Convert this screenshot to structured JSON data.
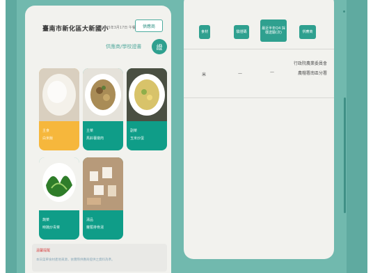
{
  "header": {
    "school_name": "臺南市新化區大新國小",
    "date": "2025年3月17日 午餐",
    "supplier_button": "供應商",
    "supplier_link": "供應商/學校證書",
    "round_button": "證"
  },
  "menu": {
    "items": [
      {
        "category": "主食",
        "name": "白米飯",
        "selected": true
      },
      {
        "category": "主菜",
        "name": "馬鈴薯燉肉",
        "selected": false
      },
      {
        "category": "副菜",
        "name": "玉米炒蛋",
        "selected": false
      },
      {
        "category": "蔬菜",
        "name": "時蔬炒青菜",
        "selected": false
      },
      {
        "category": "湯品",
        "name": "蘿蔔排骨湯",
        "selected": false
      }
    ]
  },
  "notice": {
    "title": "溫馨提醒",
    "text": "本日菜單食材產地來源，依實際供應商提供之資料為準。"
  },
  "table": {
    "headers": [
      "食材",
      "驗證碼",
      "最近半年Q4 採樣送驗(次)",
      "供應商"
    ],
    "row": {
      "ingredient": "米",
      "code": "—",
      "tests": "—",
      "agency": "行政院農業委員會農糧署南區分署"
    }
  },
  "colors": {
    "frame": "#71b9ae",
    "panel": "#f2f2ee",
    "accent": "#2fa08f",
    "highlight": "#f6b73c"
  }
}
